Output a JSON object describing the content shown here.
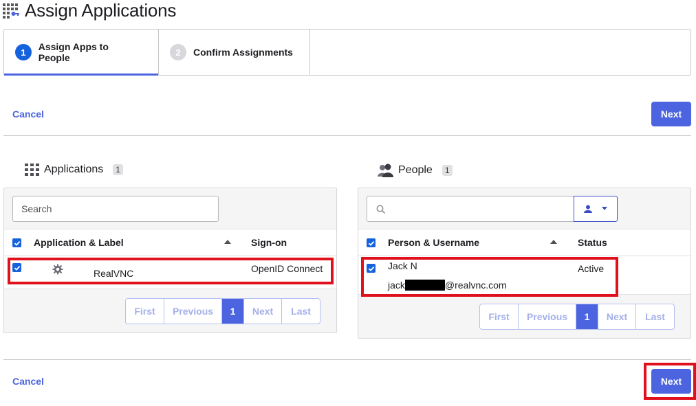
{
  "page": {
    "title": "Assign Applications",
    "title_icon": "apps-key-icon"
  },
  "wizard": {
    "steps": [
      {
        "number": "1",
        "label": "Assign Apps to People",
        "state": "active"
      },
      {
        "number": "2",
        "label": "Confirm Assignments",
        "state": "inactive"
      }
    ]
  },
  "actions": {
    "cancel_label": "Cancel",
    "next_label": "Next"
  },
  "applications": {
    "title": "Applications",
    "count": "1",
    "search_placeholder": "Search",
    "columns": [
      "Application & Label",
      "Sign-on"
    ],
    "rows": [
      {
        "name": "RealVNC",
        "sign_on": "OpenID Connect",
        "icon": "gear-icon",
        "checked": true
      }
    ],
    "pager": {
      "first": "First",
      "previous": "Previous",
      "current": "1",
      "next": "Next",
      "last": "Last"
    }
  },
  "people": {
    "title": "People",
    "count": "1",
    "search_placeholder": "",
    "columns": [
      "Person & Username",
      "Status"
    ],
    "rows": [
      {
        "name": "Jack N",
        "username_prefix": "jack",
        "username_suffix": "@realvnc.com",
        "status": "Active",
        "checked": true
      }
    ],
    "pager": {
      "first": "First",
      "previous": "Previous",
      "current": "1",
      "next": "Next",
      "last": "Last"
    }
  },
  "colors": {
    "accent": "#4c64e0",
    "highlight": "#e0101c"
  }
}
